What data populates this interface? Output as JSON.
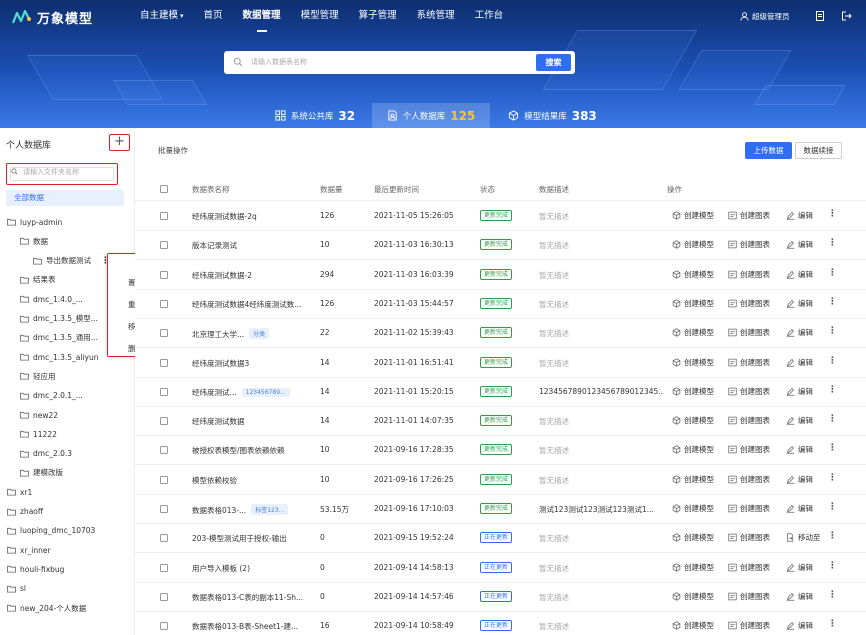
{
  "brand": {
    "name": "万象模型"
  },
  "nav": {
    "items": [
      {
        "label": "自主建模",
        "caret": "▾"
      },
      {
        "label": "首页"
      },
      {
        "label": "数据管理",
        "active": true
      },
      {
        "label": "模型管理"
      },
      {
        "label": "算子管理"
      },
      {
        "label": "系统管理"
      },
      {
        "label": "工作台"
      }
    ]
  },
  "user": {
    "name": "超级管理员"
  },
  "search": {
    "placeholder": "请输入数据表名称",
    "button": "搜索"
  },
  "tabs": [
    {
      "label": "系统公共库",
      "count": "32",
      "icon": "grid-icon"
    },
    {
      "label": "个人数据库",
      "count": "125",
      "icon": "personal-db-icon",
      "active": true
    },
    {
      "label": "模型结果库",
      "count": "383",
      "icon": "cube-icon"
    }
  ],
  "sidebar": {
    "title": "个人数据库",
    "add": "+",
    "filter_placeholder": "请输入文件夹名称",
    "all": "全部数据",
    "tree": [
      {
        "label": "luyp-admin",
        "depth": 0,
        "expanded": true
      },
      {
        "label": "数据",
        "depth": 1,
        "expanded": true
      },
      {
        "label": "导出数据测试",
        "depth": 2,
        "file": true,
        "more": "⋮"
      },
      {
        "label": "结果表",
        "depth": 1
      },
      {
        "label": "dmc_1.4.0_...",
        "depth": 1
      },
      {
        "label": "dmc_1.3.5_模型...",
        "depth": 1
      },
      {
        "label": "dmc_1.3.5_通用...",
        "depth": 1
      },
      {
        "label": "dmc_1.3.5_aliyun",
        "depth": 1
      },
      {
        "label": "轻应用",
        "depth": 1
      },
      {
        "label": "dmc_2.0.1_...",
        "depth": 1
      },
      {
        "label": "new22",
        "depth": 1
      },
      {
        "label": "11222",
        "depth": 1
      },
      {
        "label": "dmc_2.0.3",
        "depth": 1
      },
      {
        "label": "建模改版",
        "depth": 1
      },
      {
        "label": "xr1",
        "depth": 0
      },
      {
        "label": "zhaoff",
        "depth": 0
      },
      {
        "label": "luoping_dmc_10703",
        "depth": 0
      },
      {
        "label": "xr_inner",
        "depth": 0
      },
      {
        "label": "houli-fixbug",
        "depth": 0
      },
      {
        "label": "sl",
        "depth": 0
      },
      {
        "label": "new_204-个人数据",
        "depth": 0
      }
    ],
    "context_menu": [
      "置顶",
      "重命名",
      "移动至",
      "删除"
    ]
  },
  "toolbar": {
    "batch": "批量操作",
    "upload": "上传数据",
    "continue": "数据续接"
  },
  "table": {
    "headers": {
      "name": "数据表名称",
      "count": "数据量",
      "updated": "最后更新时间",
      "status": "状态",
      "desc": "数据描述",
      "ops": "操作"
    },
    "rows": [
      {
        "name": "经纬度测试数据-2q",
        "count": "126",
        "updated": "2021-11-05 15:26:05",
        "status": "更新完成",
        "desc": "暂无描述",
        "ops": [
          "创建模型",
          "创建图表",
          "编辑"
        ]
      },
      {
        "name": "版本记录测试",
        "count": "10",
        "updated": "2021-11-03 16:30:13",
        "status": "更新完成",
        "desc": "暂无描述",
        "ops": [
          "创建模型",
          "创建图表",
          "编辑"
        ]
      },
      {
        "name": "经纬度测试数据-2",
        "count": "294",
        "updated": "2021-11-03 16:03:39",
        "status": "更新完成",
        "desc": "暂无描述",
        "ops": [
          "创建模型",
          "创建图表",
          "编辑"
        ]
      },
      {
        "name": "经纬度测试数据4经纬度测试数...",
        "count": "126",
        "updated": "2021-11-03 15:44:57",
        "status": "更新完成",
        "desc": "暂无描述",
        "ops": [
          "创建模型",
          "创建图表",
          "编辑"
        ]
      },
      {
        "name": "北京理工大学...",
        "tag": "分类",
        "count": "22",
        "updated": "2021-11-02 15:39:43",
        "status": "更新完成",
        "desc": "暂无描述",
        "ops": [
          "创建模型",
          "创建图表",
          "编辑"
        ]
      },
      {
        "name": "经纬度测试数据3",
        "count": "14",
        "updated": "2021-11-01 16:51:41",
        "status": "更新完成",
        "desc": "暂无描述",
        "ops": [
          "创建模型",
          "创建图表",
          "编辑"
        ]
      },
      {
        "name": "经纬度测试...",
        "tag": "123456789...",
        "count": "14",
        "updated": "2021-11-01 15:20:15",
        "status": "更新完成",
        "desc": "1234567890123456789012345...",
        "ops": [
          "创建模型",
          "创建图表",
          "编辑"
        ]
      },
      {
        "name": "经纬度测试数据",
        "count": "14",
        "updated": "2021-11-01 14:07:35",
        "status": "更新完成",
        "desc": "暂无描述",
        "ops": [
          "创建模型",
          "创建图表",
          "编辑"
        ]
      },
      {
        "name": "被授权表模型/图表依赖依赖",
        "count": "10",
        "updated": "2021-09-16 17:28:35",
        "status": "更新完成",
        "desc": "暂无描述",
        "ops": [
          "创建模型",
          "创建图表",
          "编辑"
        ]
      },
      {
        "name": "模型依赖校验",
        "count": "10",
        "updated": "2021-09-16 17:26:25",
        "status": "更新完成",
        "desc": "暂无描述",
        "ops": [
          "创建模型",
          "创建图表",
          "编辑"
        ]
      },
      {
        "name": "数据表格013-...",
        "tag": "标签123...",
        "count": "53.15万",
        "updated": "2021-09-16 17:10:03",
        "status": "更新完成",
        "desc": "测试123测试123测试123测试1...",
        "ops": [
          "创建模型",
          "创建图表",
          "编辑"
        ]
      },
      {
        "name": "203-模型测试用于授权-输出",
        "count": "0",
        "updated": "2021-09-15 19:52:24",
        "status": "正在更新",
        "statusType": "b",
        "desc": "暂无描述",
        "ops": [
          "创建模型",
          "创建图表",
          "移动至"
        ]
      },
      {
        "name": "用户导入模板 (2)",
        "count": "0",
        "updated": "2021-09-14 14:58:13",
        "status": "正在更新",
        "statusType": "b",
        "desc": "暂无描述",
        "ops": [
          "创建模型",
          "创建图表",
          "编辑"
        ]
      },
      {
        "name": "数据表格013-C表的副本11-Sh...",
        "count": "0",
        "updated": "2021-09-14 14:57:46",
        "status": "正在更新",
        "statusType": "b",
        "desc": "暂无描述",
        "ops": [
          "创建模型",
          "创建图表",
          "编辑"
        ]
      },
      {
        "name": "数据表格013-B表-Sheet1-建...",
        "count": "16",
        "updated": "2021-09-14 10:58:49",
        "status": "正在更新",
        "statusType": "b",
        "desc": "暂无描述",
        "ops": [
          "创建模型",
          "创建图表",
          "编辑"
        ]
      }
    ]
  },
  "colors": {
    "accent": "#2f6ef2",
    "highlight": "#ffc42e",
    "success": "#2e9e4a",
    "alert_outline": "#e02020"
  }
}
